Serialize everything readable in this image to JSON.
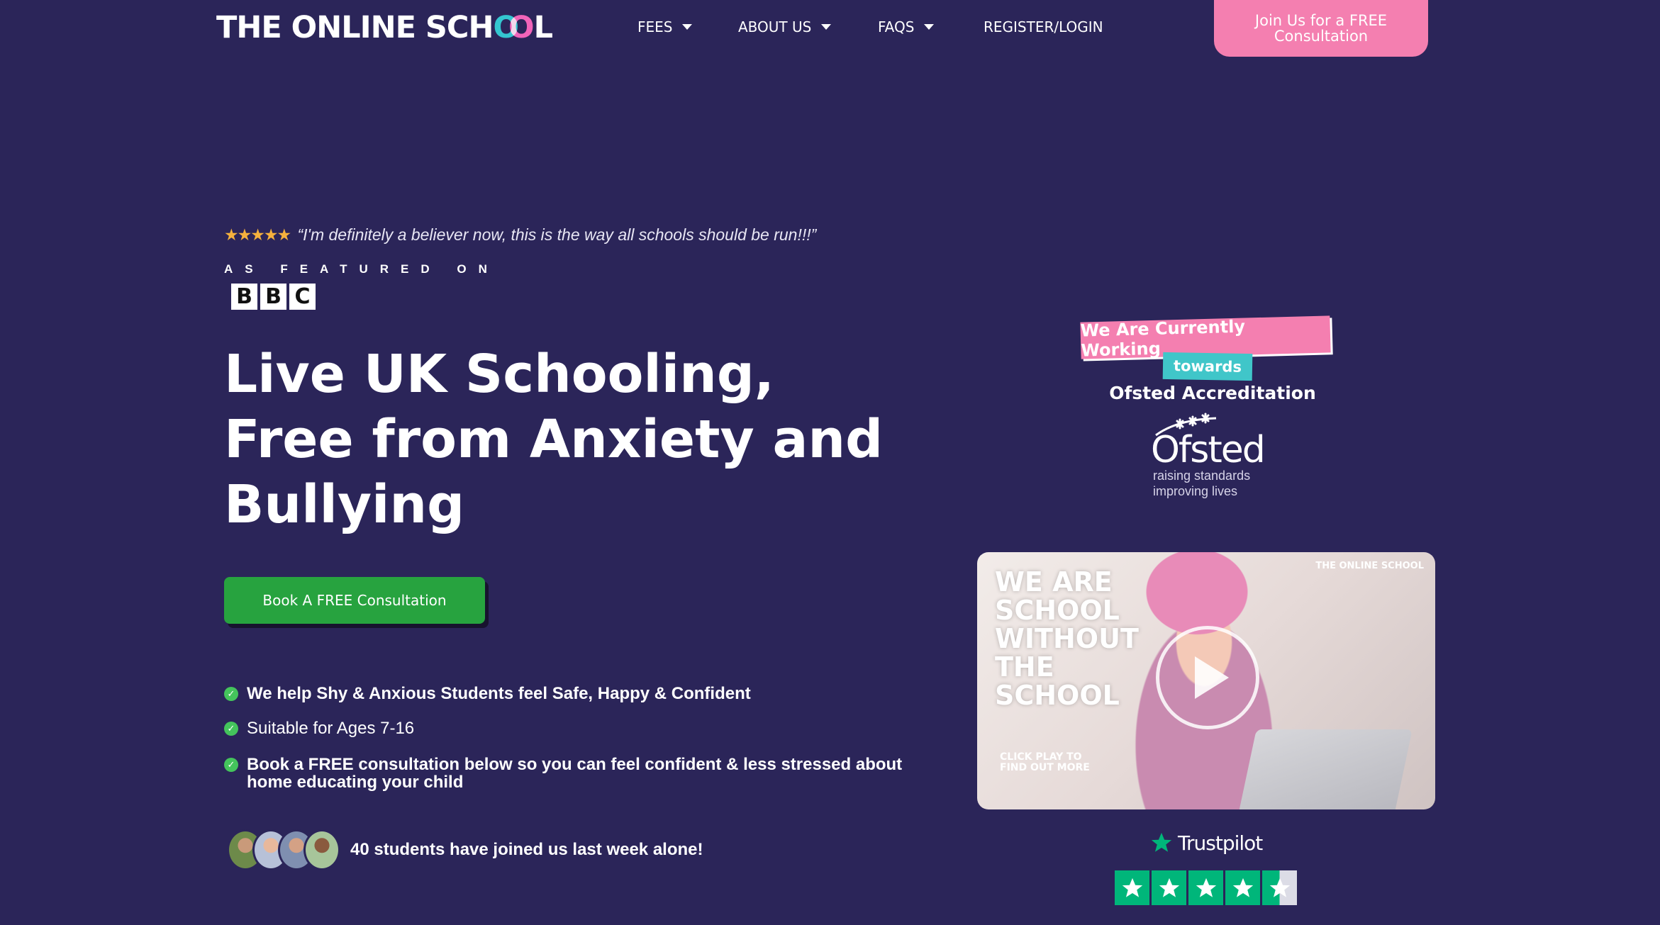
{
  "header": {
    "logo": {
      "prefix": "THE ONLINE SCH",
      "o1": "O",
      "o2": "O",
      "suffix": "L"
    },
    "nav": [
      {
        "label": "FEES",
        "has_dropdown": true
      },
      {
        "label": "ABOUT US",
        "has_dropdown": true
      },
      {
        "label": "FAQS",
        "has_dropdown": true
      },
      {
        "label": "REGISTER/LOGIN",
        "has_dropdown": false
      }
    ],
    "cta_label": "Join Us for a FREE Consultation"
  },
  "hero": {
    "review_stars": "★★★★★",
    "review_quote": "“I'm definitely a believer now, this is the way all schools should be run!!!”",
    "featured_label": "AS FEATURED ON",
    "featured_logo": [
      "B",
      "B",
      "C"
    ],
    "headline": "Live UK Schooling, Free from Anxiety and Bullying",
    "cta_label": "Book A FREE Consultation",
    "bullets": [
      {
        "text": "We help Shy & Anxious Students feel Safe, Happy & Confident",
        "bold": true
      },
      {
        "text": "Suitable for Ages 7-16",
        "bold": false
      },
      {
        "text": "Book a FREE consultation below so you can feel confident & less stressed about home educating your child",
        "bold": true
      }
    ],
    "joined_text": "40 students have joined us last week alone!"
  },
  "ofsted": {
    "banner_1": "We Are Currently Working",
    "banner_2": "towards",
    "banner_3": "Ofsted Accreditation",
    "logo_text": "Ofsted",
    "tagline_1": "raising standards",
    "tagline_2": "improving lives"
  },
  "video": {
    "title_lines": [
      "WE ARE",
      "SCHOOL",
      "WITHOUT",
      "THE",
      "SCHOOL"
    ],
    "brand": "THE ONLINE SCHOOL",
    "click_text": "CLICK PLAY TO FIND OUT MORE"
  },
  "trustpilot": {
    "label": "Trustpilot",
    "rating_stars": 4.5
  },
  "colors": {
    "background": "#2b2559",
    "pink": "#f47fb0",
    "green": "#27a33f",
    "teal": "#40c6c9",
    "trustpilot_green": "#00b67a"
  }
}
